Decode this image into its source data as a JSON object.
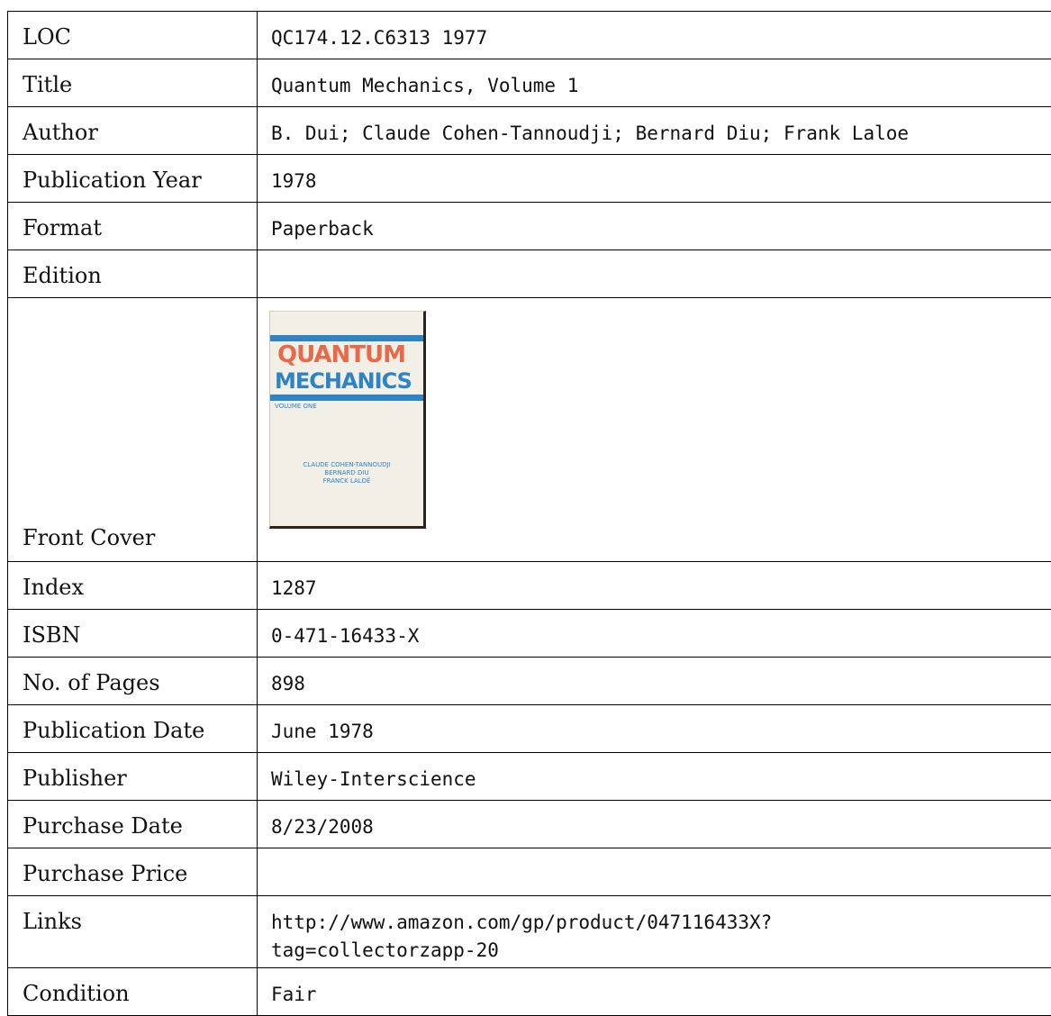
{
  "rows": {
    "loc": {
      "label": "LOC",
      "value": "QC174.12.C6313 1977"
    },
    "title": {
      "label": "Title",
      "value": "Quantum Mechanics, Volume 1"
    },
    "author": {
      "label": "Author",
      "value": "B. Dui; Claude Cohen-Tannoudji; Bernard Diu; Frank Laloe"
    },
    "pub_year": {
      "label": "Publication Year",
      "value": "1978"
    },
    "format": {
      "label": "Format",
      "value": "Paperback"
    },
    "edition": {
      "label": "Edition",
      "value": ""
    },
    "front_cover": {
      "label": "Front Cover"
    },
    "index": {
      "label": "Index",
      "value": "1287"
    },
    "isbn": {
      "label": "ISBN",
      "value": "0-471-16433-X"
    },
    "pages": {
      "label": "No. of Pages",
      "value": "898"
    },
    "pub_date": {
      "label": "Publication Date",
      "value": "June 1978"
    },
    "publisher": {
      "label": "Publisher",
      "value": "Wiley-Interscience"
    },
    "purchase_date": {
      "label": "Purchase Date",
      "value": "8/23/2008"
    },
    "purchase_price": {
      "label": "Purchase Price",
      "value": ""
    },
    "links": {
      "label": "Links",
      "value": "http://www.amazon.com/gp/product/047116433X?tag=collectorzapp-20"
    },
    "condition": {
      "label": "Condition",
      "value": "Fair"
    }
  },
  "cover": {
    "line1": "QUANTUM",
    "line2": "MECHANICS",
    "volume": "VOLUME ONE",
    "authors": [
      "CLAUDE COHEN-TANNOUDJI",
      "BERNARD DIU",
      "FRANCK LALOË"
    ],
    "colors": {
      "orange": "#e8684a",
      "blue": "#2e83c4",
      "paper": "#f2efe6"
    }
  }
}
